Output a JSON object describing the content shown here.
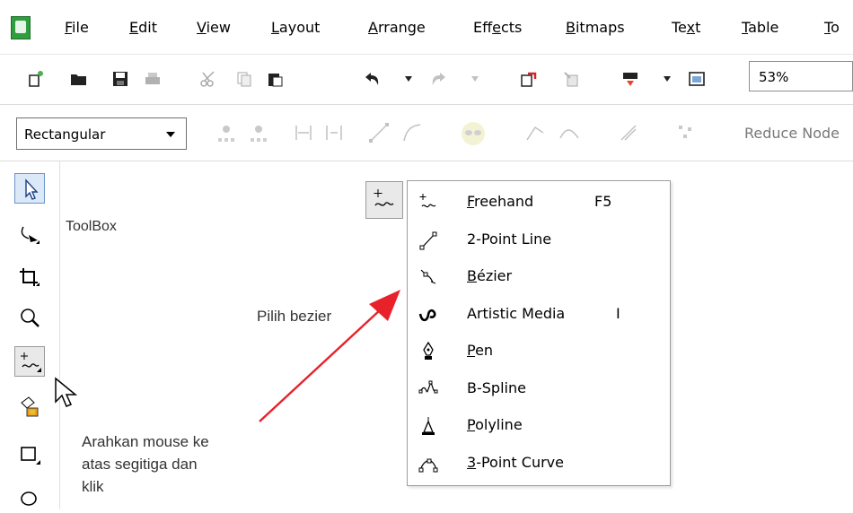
{
  "menu": {
    "items": [
      {
        "pre": "",
        "u": "F",
        "post": "ile"
      },
      {
        "pre": "",
        "u": "E",
        "post": "dit"
      },
      {
        "pre": "",
        "u": "V",
        "post": "iew"
      },
      {
        "pre": "",
        "u": "L",
        "post": "ayout"
      },
      {
        "pre": "",
        "u": "A",
        "post": "rrange"
      },
      {
        "pre": "Eff",
        "u": "e",
        "post": "cts"
      },
      {
        "pre": "",
        "u": "B",
        "post": "itmaps"
      },
      {
        "pre": "Te",
        "u": "x",
        "post": "t"
      },
      {
        "pre": "",
        "u": "T",
        "post": "able"
      },
      {
        "pre": "",
        "u": "T",
        "post": "o"
      }
    ]
  },
  "toolbar": {
    "zoom_value": "53%"
  },
  "property_bar": {
    "shape_mode": "Rectangular",
    "reduce_nodes": "Reduce Node"
  },
  "toolbox": {
    "label": "ToolBox"
  },
  "flyout": {
    "items": [
      {
        "pre": "",
        "u": "F",
        "post": "reehand",
        "key": "F5",
        "icon": "freehand-icon"
      },
      {
        "pre": "2-Point Line",
        "u": "",
        "post": "",
        "key": "",
        "icon": "line-icon"
      },
      {
        "pre": "",
        "u": "B",
        "post": "ézier",
        "key": "",
        "icon": "bezier-icon"
      },
      {
        "pre": "Artistic Media",
        "u": "",
        "post": "",
        "key": "I",
        "icon": "artistic-media-icon"
      },
      {
        "pre": "",
        "u": "P",
        "post": "en",
        "key": "",
        "icon": "pen-icon"
      },
      {
        "pre": "B-Spline",
        "u": "",
        "post": "",
        "key": "",
        "icon": "b-spline-icon"
      },
      {
        "pre": "",
        "u": "P",
        "post": "olyline",
        "key": "",
        "icon": "polyline-icon"
      },
      {
        "pre": "",
        "u": "3",
        "post": "-Point Curve",
        "key": "",
        "icon": "3-point-curve-icon"
      }
    ]
  },
  "annotations": {
    "choose": "Pilih bezier",
    "instruction_lines": [
      "Arahkan mouse ke",
      "atas segitiga dan",
      "klik"
    ]
  },
  "colors": {
    "arrow": "#e8212a",
    "active_tool": "#dbe8f7"
  }
}
